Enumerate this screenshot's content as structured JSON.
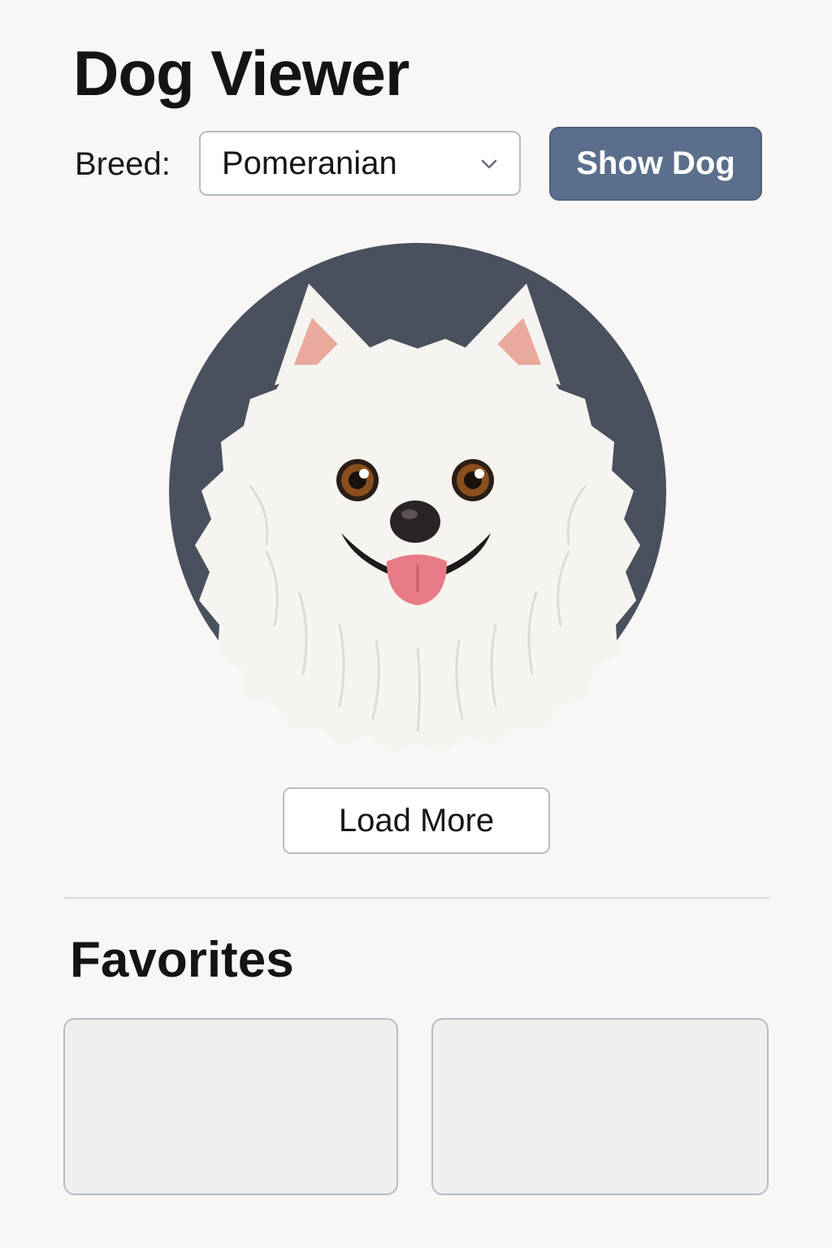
{
  "app": {
    "title": "Dog Viewer"
  },
  "controls": {
    "breed_label": "Breed:",
    "breed_select": {
      "selected": "Pomeranian"
    },
    "show_button_label": "Show Dog"
  },
  "dog_image": {
    "breed": "Pomeranian",
    "description": "Illustrated white Pomeranian head on dark slate circle"
  },
  "load_more_label": "Load More",
  "favorites": {
    "title": "Favorites",
    "slots": [
      {
        "content": ""
      },
      {
        "content": ""
      }
    ]
  },
  "colors": {
    "background": "#f8f7f5",
    "accent_button": "#5b6e8b",
    "image_circle": "#4a505e",
    "border": "#b9bcc6",
    "favorite_slot_fill": "#f0efee"
  },
  "icons": {
    "select_chevron": "chevron-down-icon"
  }
}
